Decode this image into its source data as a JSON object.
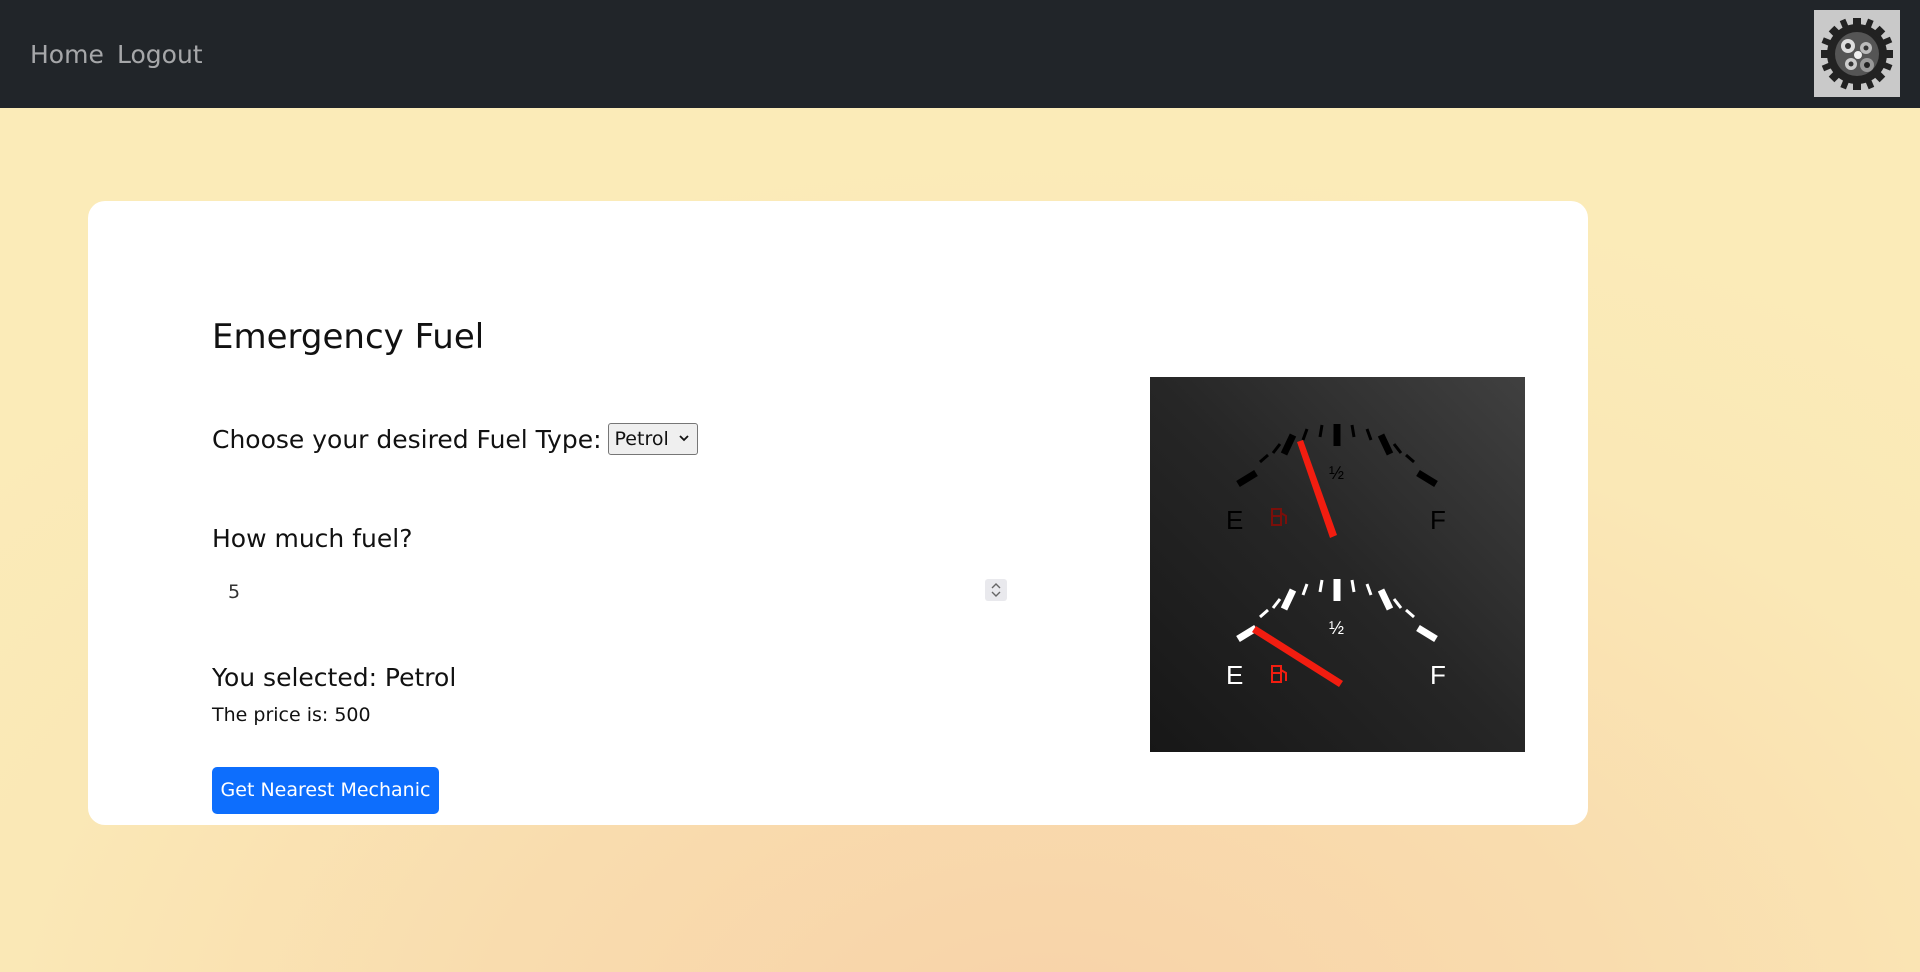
{
  "nav": {
    "home": "Home",
    "logout": "Logout",
    "logo_icon": "gear-cluster-icon"
  },
  "main": {
    "title": "Emergency Fuel",
    "fuel_type_label": "Choose your desired Fuel Type:",
    "fuel_type_selected": "Petrol",
    "amount_label": "How much fuel?",
    "amount_value": "5",
    "selected_text": "You selected: Petrol",
    "price_text": "The price is: 500",
    "mechanic_button": "Get Nearest Mechanic"
  },
  "gauge": {
    "top": {
      "e": "E",
      "half": "½",
      "f": "F"
    },
    "bottom": {
      "e": "E",
      "half": "½",
      "f": "F"
    },
    "needle_color": "#f21d10",
    "icon": "fuel-pump-icon"
  },
  "colors": {
    "navbar": "#212529",
    "button": "#0d6efd"
  }
}
